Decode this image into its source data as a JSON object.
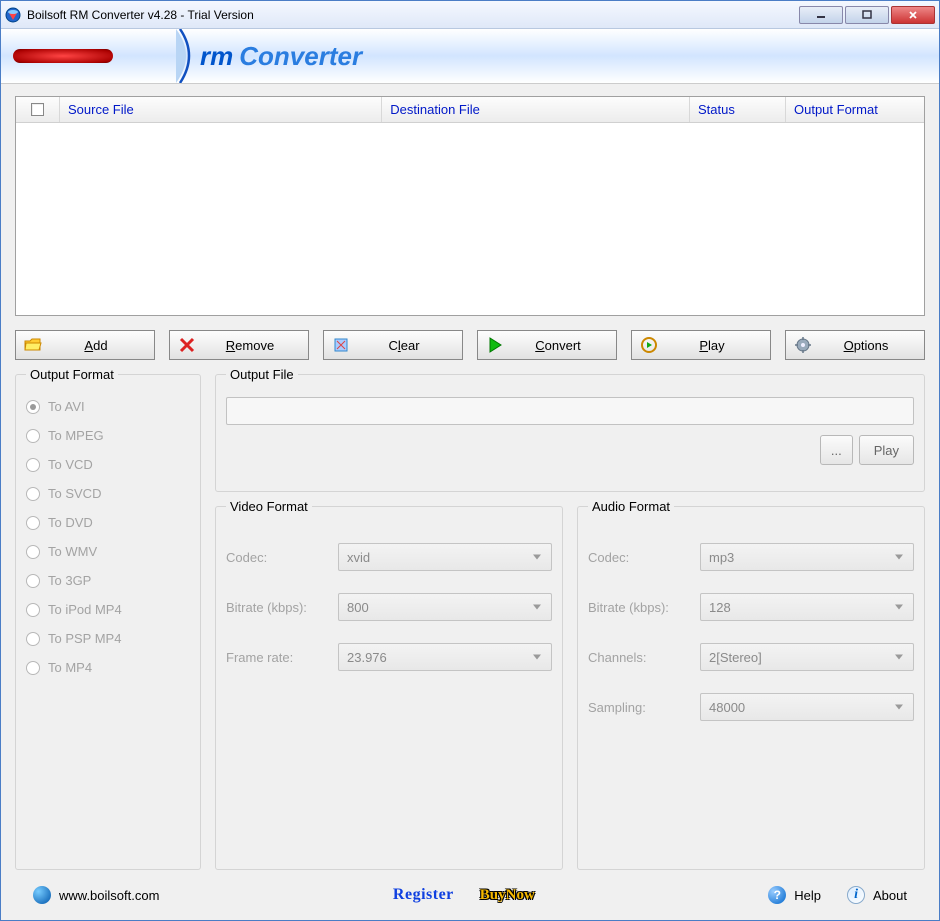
{
  "titlebar": {
    "title": "Boilsoft RM Converter v4.28 - Trial Version"
  },
  "banner": {
    "rm": "rm",
    "converter": "Converter"
  },
  "list": {
    "cols": {
      "src": "Source File",
      "dst": "Destination File",
      "status": "Status",
      "fmt": "Output Format"
    }
  },
  "toolbar": {
    "add": "Add",
    "remove": "Remove",
    "clear": "Clear",
    "convert": "Convert",
    "play": "Play",
    "options": "Options"
  },
  "output_format": {
    "title": "Output Format",
    "items": [
      "To AVI",
      "To MPEG",
      "To VCD",
      "To SVCD",
      "To DVD",
      "To WMV",
      "To 3GP",
      "To iPod MP4",
      "To PSP MP4",
      "To MP4"
    ]
  },
  "output_file": {
    "title": "Output File",
    "browse": "...",
    "play": "Play"
  },
  "video_format": {
    "title": "Video Format",
    "codec_label": "Codec:",
    "codec": "xvid",
    "bitrate_label": "Bitrate (kbps):",
    "bitrate": "800",
    "framerate_label": "Frame rate:",
    "framerate": "23.976"
  },
  "audio_format": {
    "title": "Audio Format",
    "codec_label": "Codec:",
    "codec": "mp3",
    "bitrate_label": "Bitrate (kbps):",
    "bitrate": "128",
    "channels_label": "Channels:",
    "channels": "2[Stereo]",
    "sampling_label": "Sampling:",
    "sampling": "48000"
  },
  "footer": {
    "url": "www.boilsoft.com",
    "register": "Register",
    "buynow": "BuyNow",
    "help": "Help",
    "about": "About"
  }
}
